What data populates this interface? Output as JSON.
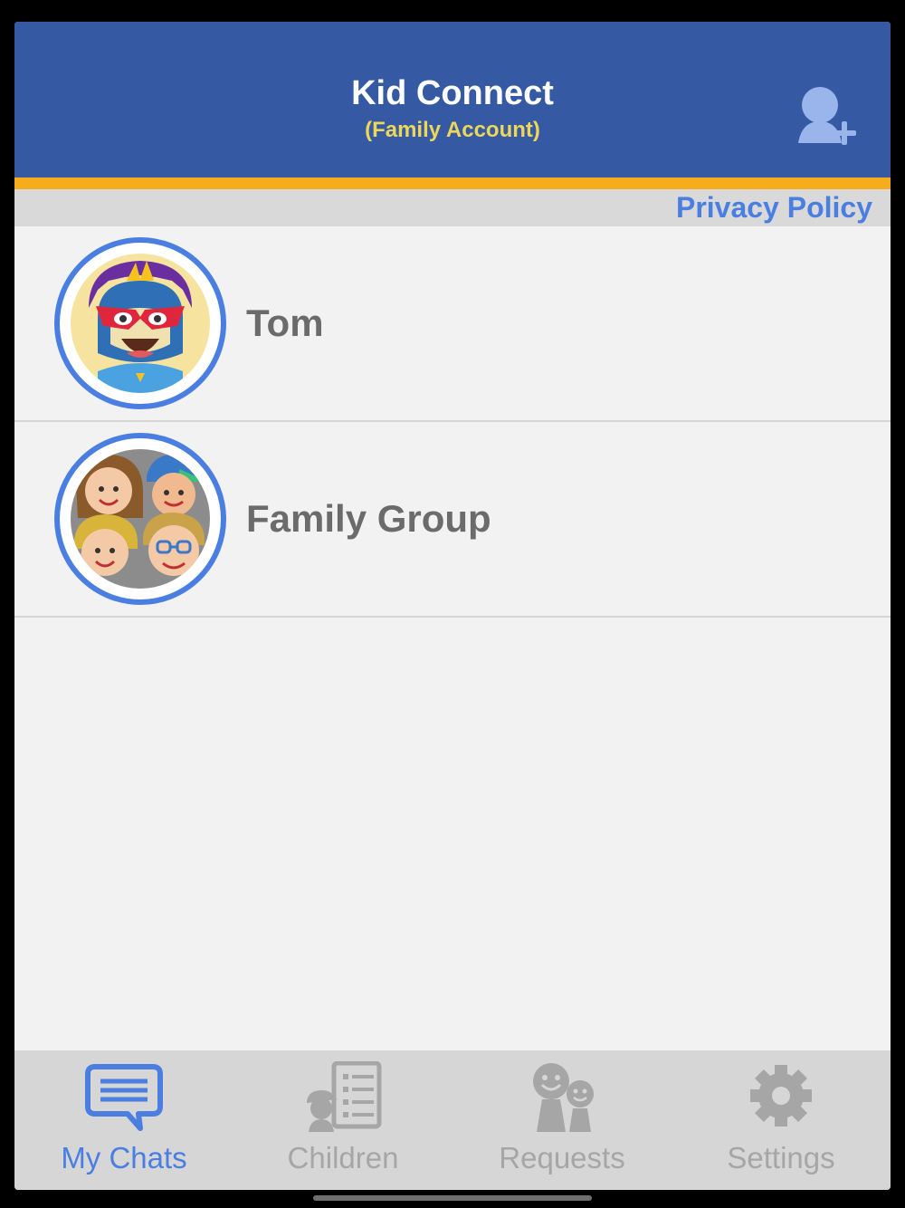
{
  "header": {
    "title": "Kid Connect",
    "subtitle": "(Family Account)"
  },
  "privacy_link": "Privacy Policy",
  "chats": [
    {
      "name": "Tom",
      "avatar": "superhero-avatar"
    },
    {
      "name": "Family Group",
      "avatar": "family-group-avatar"
    }
  ],
  "tabs": [
    {
      "label": "My Chats",
      "icon": "chat-bubble-icon",
      "active": true
    },
    {
      "label": "Children",
      "icon": "children-list-icon",
      "active": false
    },
    {
      "label": "Requests",
      "icon": "requests-icon",
      "active": false
    },
    {
      "label": "Settings",
      "icon": "gear-icon",
      "active": false
    }
  ],
  "colors": {
    "header": "#3559a2",
    "accent": "#f7ad1b",
    "link": "#4a7fe1",
    "subtitle": "#ecd75a",
    "inactive_tab": "#a6a6a6"
  }
}
